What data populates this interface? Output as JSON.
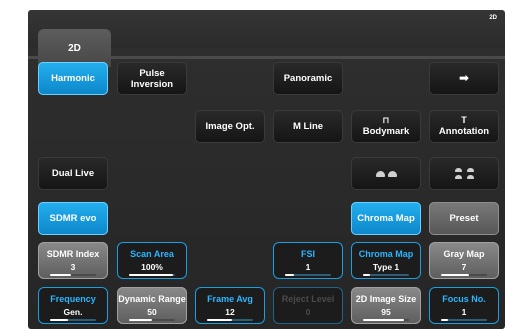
{
  "corner_label": "2D",
  "tab": {
    "label": "2D"
  },
  "buttons": {
    "harmonic": "Harmonic",
    "pulse_inversion_line1": "Pulse",
    "pulse_inversion_line2": "Inversion",
    "panoramic": "Panoramic",
    "next_arrow": "➡",
    "image_opt": "Image Opt.",
    "m_line": "M Line",
    "bodymark": "Bodymark",
    "annotation": "Annotation",
    "dual_live": "Dual Live",
    "sdmr_evo": "SDMR evo",
    "chroma_map": "Chroma Map",
    "preset": "Preset"
  },
  "icons": {
    "bodymark": "bodymark-icon",
    "annotation": "annotation-icon",
    "next": "arrow-right-icon",
    "bodymark_dual": "bodymark-dual-icon",
    "bodymark_quad": "bodymark-quad-icon"
  },
  "annotation_glyph": "T",
  "bodymark_glyph": "⊓",
  "knobs_row1": [
    {
      "title": "SDMR Index",
      "value": "3",
      "level": 0.45
    },
    {
      "title": "Scan Area",
      "value": "100%",
      "level": 0.95
    },
    {
      "title": "FSI",
      "value": "1",
      "level": 0.2
    },
    {
      "title": "Chroma Map",
      "value": "Type 1",
      "level": 0.15
    },
    {
      "title": "Gray Map",
      "value": "7",
      "level": 0.6
    }
  ],
  "knobs_row2": [
    {
      "title": "Frequency",
      "value": "Gen.",
      "level": 0.4
    },
    {
      "title": "Dynamic Range",
      "value": "50",
      "level": 0.5
    },
    {
      "title": "Frame Avg",
      "value": "12",
      "level": 0.55
    },
    {
      "title": "Reject Level",
      "value": "0",
      "level": 0
    },
    {
      "title": "2D Image Size",
      "value": "95",
      "level": 0.9
    },
    {
      "title": "Focus No.",
      "value": "1",
      "level": 0.15
    }
  ],
  "colors": {
    "active_blue": "#1a9fe2",
    "panel_bg": "#2b2b2b"
  }
}
